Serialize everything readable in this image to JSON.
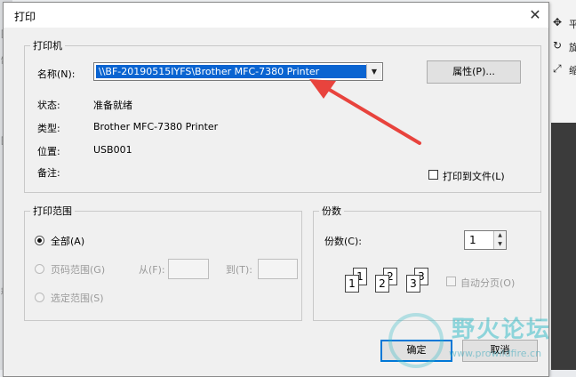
{
  "dialog": {
    "title": "打印",
    "close_glyph": "✕"
  },
  "printer_group": {
    "legend": "打印机",
    "name_label": "名称(N):",
    "name_value": "\\\\BF-20190515IYFS\\Brother MFC-7380 Printer",
    "properties_button": "属性(P)...",
    "status_label": "状态:",
    "status_value": "准备就绪",
    "type_label": "类型:",
    "type_value": "Brother MFC-7380 Printer",
    "location_label": "位置:",
    "location_value": "USB001",
    "comment_label": "备注:",
    "print_to_file_label": "打印到文件(L)",
    "print_to_file_checked": false
  },
  "range_group": {
    "legend": "打印范围",
    "all_label": "全部(A)",
    "pages_label": "页码范围(G)",
    "from_label": "从(F):",
    "to_label": "到(T):",
    "selection_label": "选定范围(S)",
    "selected": "all"
  },
  "copies_group": {
    "legend": "份数",
    "copies_label": "份数(C):",
    "copies_value": "1",
    "collate_label": "自动分页(O)",
    "collate_checked": false
  },
  "buttons": {
    "ok": "确定",
    "cancel": "取消"
  },
  "watermark": {
    "text": "野火论坛",
    "url": "www.prowildfire.cn"
  },
  "background": {
    "right_items": [
      "平",
      "旋",
      "缩"
    ]
  },
  "colors": {
    "selection_blue": "#0a64d1",
    "arrow_red": "#e8433d",
    "ok_border": "#0078d7"
  }
}
